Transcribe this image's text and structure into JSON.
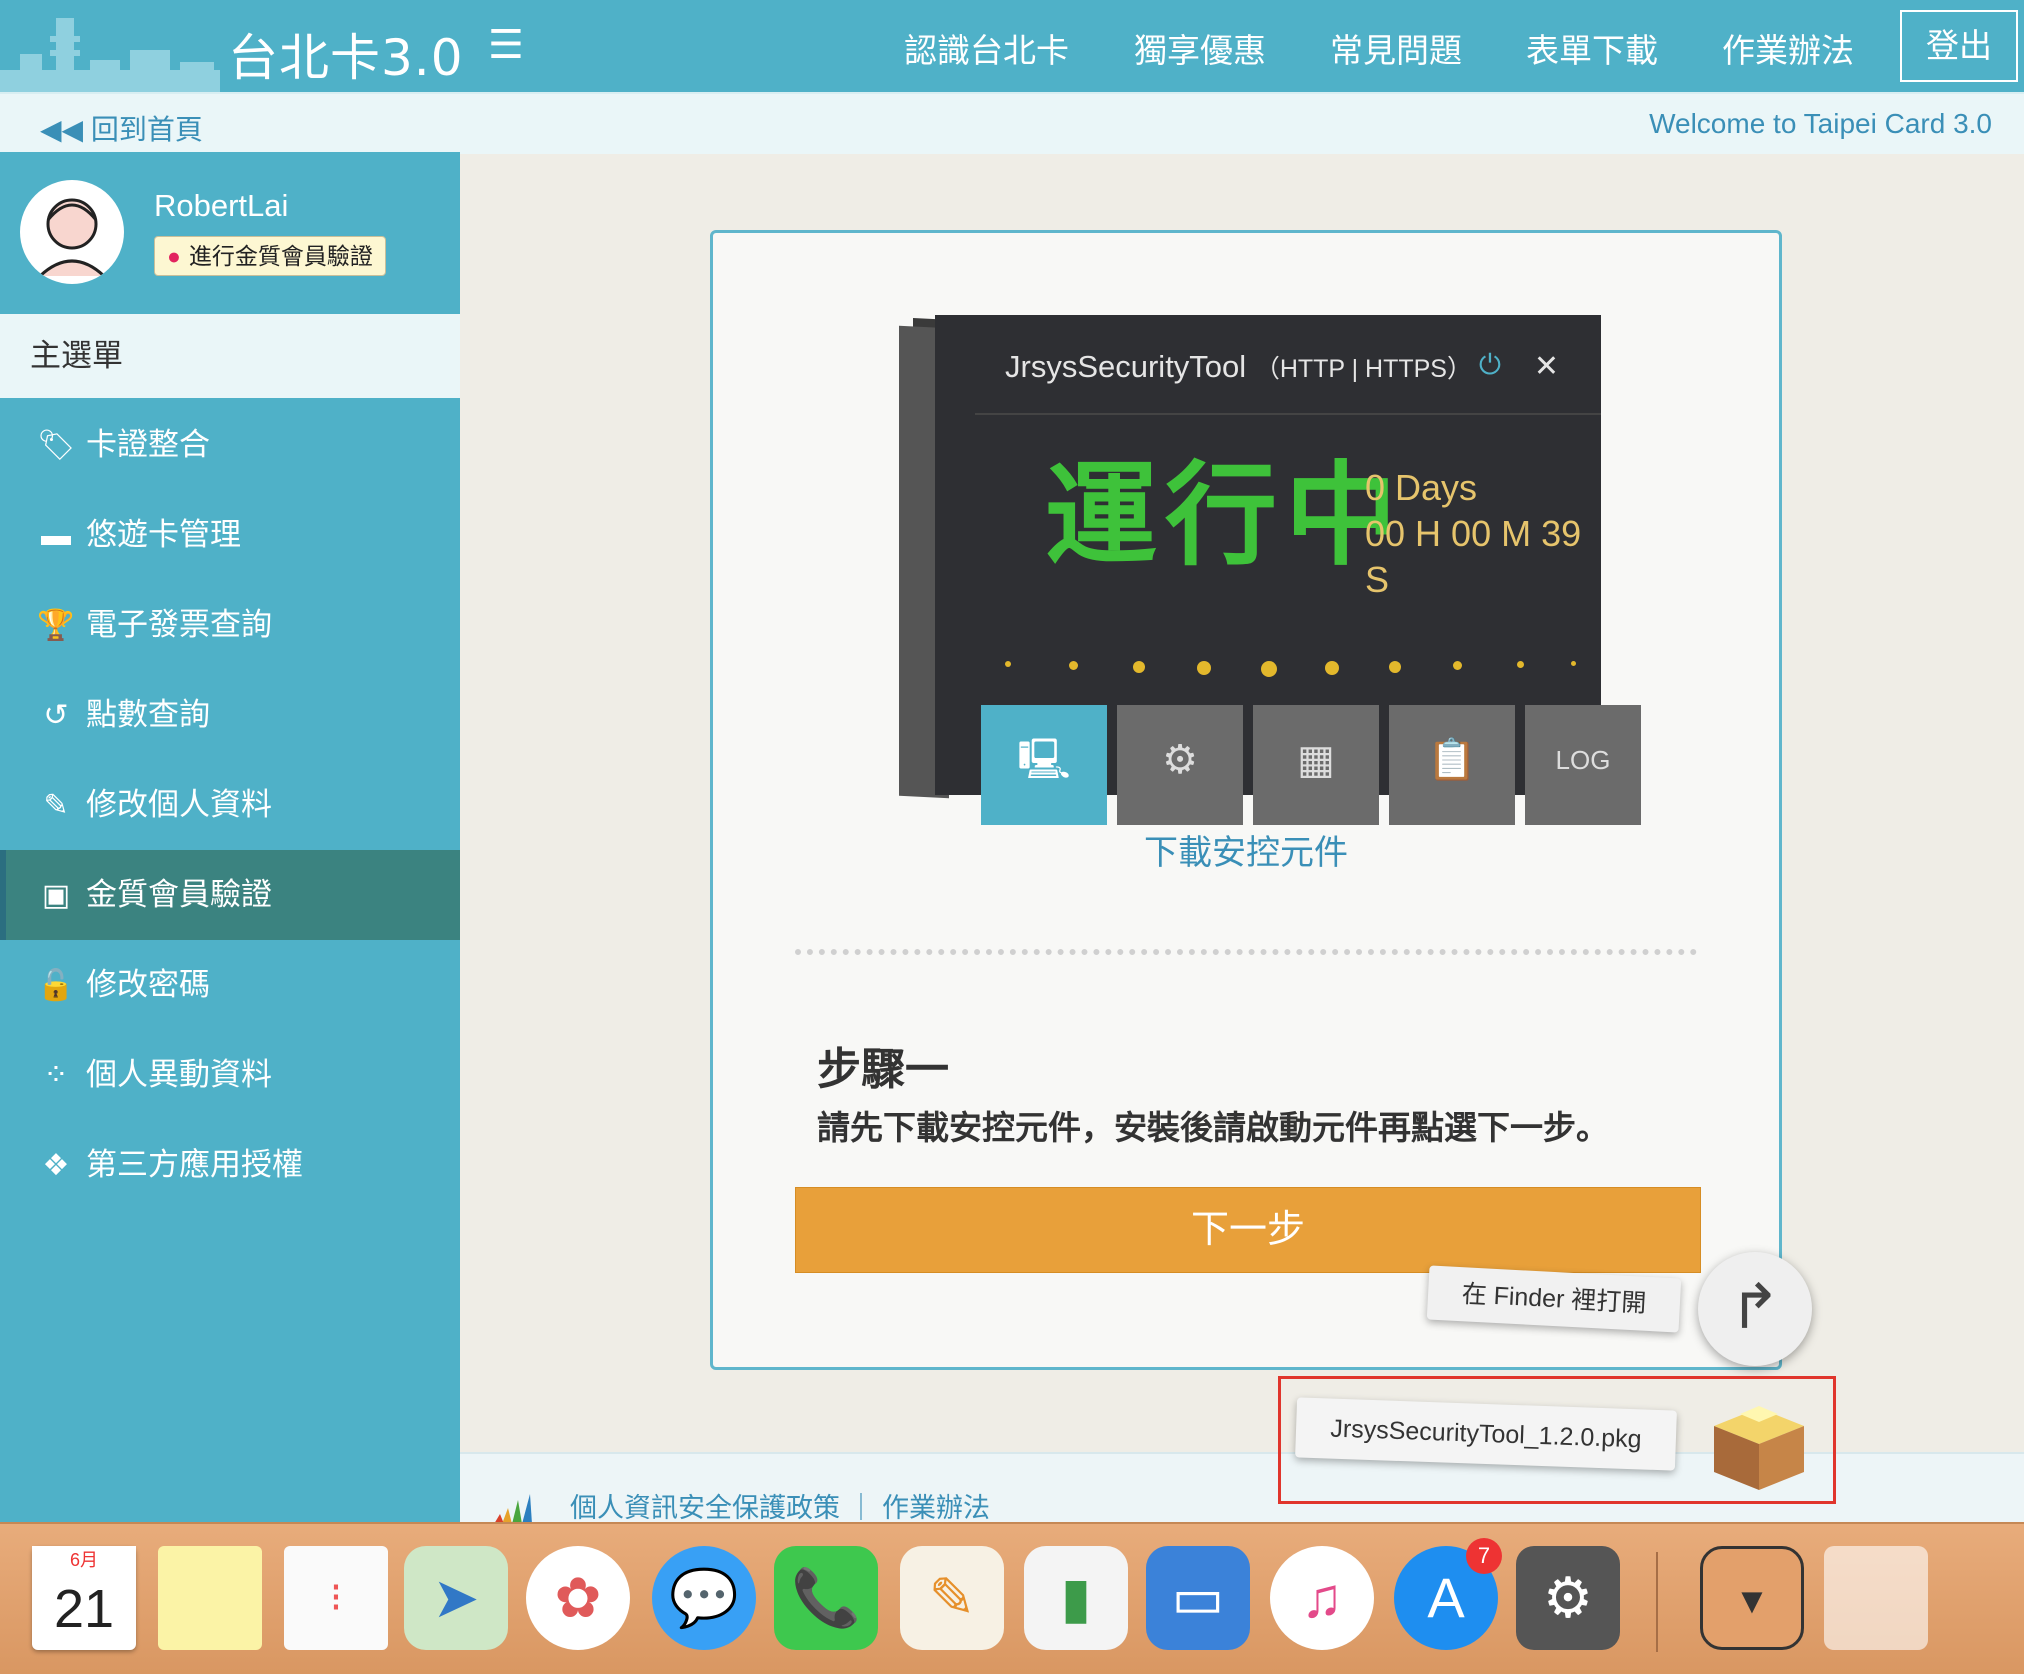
{
  "topbar": {
    "brand": "台北卡3.0",
    "nav": [
      "認識台北卡",
      "獨享優惠",
      "常見問題",
      "表單下載",
      "作業辦法"
    ],
    "logout": "登出"
  },
  "subbar": {
    "back": "◀◀ 回到首頁",
    "welcome": "Welcome to Taipei Card 3.0"
  },
  "sidebar": {
    "username": "RobertLai",
    "badge": "進行金質會員驗證",
    "main_menu": "主選單",
    "items": [
      {
        "label": "卡證整合",
        "icon": "tags-icon"
      },
      {
        "label": "悠遊卡管理",
        "icon": "card-icon"
      },
      {
        "label": "電子發票查詢",
        "icon": "trophy-icon"
      },
      {
        "label": "點數查詢",
        "icon": "history-icon"
      },
      {
        "label": "修改個人資料",
        "icon": "edit-icon"
      },
      {
        "label": "金質會員驗證",
        "icon": "id-card-icon",
        "active": true
      },
      {
        "label": "修改密碼",
        "icon": "unlock-icon"
      },
      {
        "label": "個人異動資料",
        "icon": "spinner-icon"
      },
      {
        "label": "第三方應用授權",
        "icon": "cubes-icon"
      }
    ]
  },
  "tool": {
    "title": "JrsysSecurityTool",
    "subtitle": "（HTTP | HTTPS）",
    "status": "運行中",
    "days": "0 Days",
    "time": "00 H 00 M 39 S"
  },
  "card": {
    "download_link": "下載安控元件",
    "step_title": "步驟一",
    "step_desc": "請先下載安控元件，安裝後請啟動元件再點選下一步。",
    "next": "下一步"
  },
  "overlay": {
    "finder_tip": "在 Finder 裡打開",
    "pkg_name": "JrsysSecurityTool_1.2.0.pkg"
  },
  "footer": {
    "links": "個人資訊安全保護政策 ｜ 作業辦法"
  },
  "dock": {
    "calendar_month": "6月",
    "calendar_day": "21",
    "appstore_badge": "7"
  },
  "colors": {
    "primary": "#4fb1c8",
    "active": "#3b8380",
    "button": "#e8a03a",
    "status": "#3ec23a"
  }
}
